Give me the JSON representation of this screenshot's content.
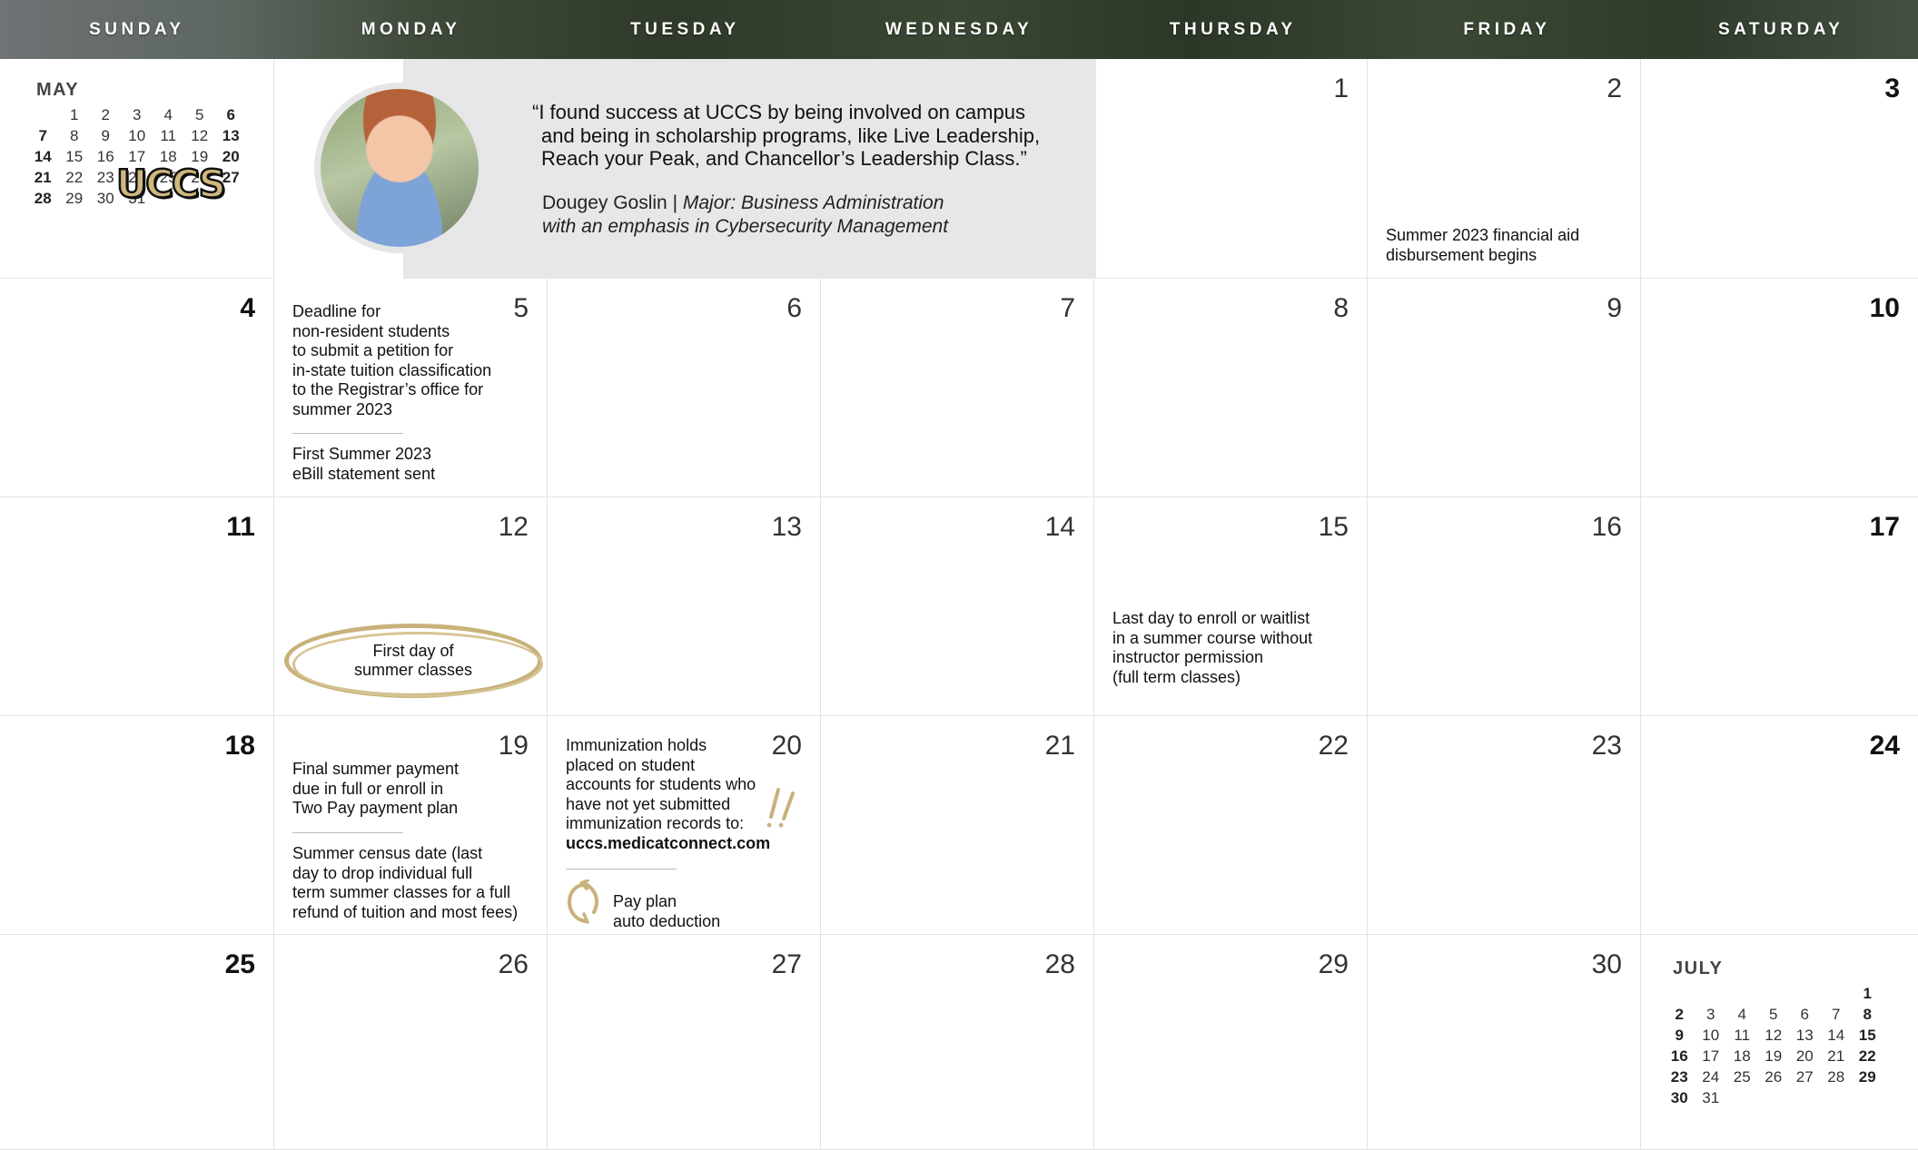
{
  "weekdays": [
    "SUNDAY",
    "MONDAY",
    "TUESDAY",
    "WEDNESDAY",
    "THURSDAY",
    "FRIDAY",
    "SATURDAY"
  ],
  "may_mini": {
    "title": "MAY",
    "rows": [
      [
        "",
        "1",
        "2",
        "3",
        "4",
        "5",
        "6"
      ],
      [
        "7",
        "8",
        "9",
        "10",
        "11",
        "12",
        "13"
      ],
      [
        "14",
        "15",
        "16",
        "17",
        "18",
        "19",
        "20"
      ],
      [
        "21",
        "22",
        "23",
        "24",
        "25",
        "26",
        "27"
      ],
      [
        "28",
        "29",
        "30",
        "31",
        "",
        "",
        ""
      ]
    ]
  },
  "july_mini": {
    "title": "JULY",
    "rows": [
      [
        "",
        "",
        "",
        "",
        "",
        "",
        "1"
      ],
      [
        "2",
        "3",
        "4",
        "5",
        "6",
        "7",
        "8"
      ],
      [
        "9",
        "10",
        "11",
        "12",
        "13",
        "14",
        "15"
      ],
      [
        "16",
        "17",
        "18",
        "19",
        "20",
        "21",
        "22"
      ],
      [
        "23",
        "24",
        "25",
        "26",
        "27",
        "28",
        "29"
      ],
      [
        "30",
        "31",
        "",
        "",
        "",
        "",
        ""
      ]
    ]
  },
  "logo_text": "UCCS",
  "banner": {
    "quote_line1": "“I found success at UCCS by being involved on campus",
    "quote_line2": "and being in scholarship programs, like Live Leadership,",
    "quote_line3": "Reach your Peak, and Chancellor’s Leadership Class.”",
    "name": "Dougey Goslin",
    "separator": " | ",
    "major_line1": "Major: Business Administration",
    "major_line2": "with an emphasis in Cybersecurity Management"
  },
  "days": {
    "d1": "1",
    "d2": "2",
    "d3": "3",
    "d4": "4",
    "d5": "5",
    "d6": "6",
    "d7": "7",
    "d8": "8",
    "d9": "9",
    "d10": "10",
    "d11": "11",
    "d12": "12",
    "d13": "13",
    "d14": "14",
    "d15": "15",
    "d16": "16",
    "d17": "17",
    "d18": "18",
    "d19": "19",
    "d20": "20",
    "d21": "21",
    "d22": "22",
    "d23": "23",
    "d24": "24",
    "d25": "25",
    "d26": "26",
    "d27": "27",
    "d28": "28",
    "d29": "29",
    "d30": "30"
  },
  "events": {
    "june2": [
      "Summer 2023 financial aid",
      "disbursement begins"
    ],
    "june5_a": [
      "Deadline for",
      "non-resident students",
      "to submit a petition for",
      "in-state tuition classification",
      "to the Registrar’s office for",
      "summer 2023"
    ],
    "june5_b": [
      "First Summer 2023",
      "eBill statement sent"
    ],
    "june12": [
      "First day of",
      "summer classes"
    ],
    "june15": [
      "Last day to enroll or waitlist",
      "in a summer course without",
      "instructor permission",
      "(full term classes)"
    ],
    "june19_a": [
      "Final summer payment",
      "due in full or enroll in",
      "Two Pay payment plan"
    ],
    "june19_b": [
      "Summer census date (last",
      "day to drop individual full",
      "term summer classes for a full",
      "refund of tuition and most fees)"
    ],
    "june20_a": [
      "Immunization holds",
      "placed on student",
      "accounts for students who",
      "have not yet submitted",
      "immunization records to:"
    ],
    "june20_url": "uccs.medicatconnect.com",
    "june20_b": [
      "Pay plan",
      "auto deduction"
    ]
  },
  "colors": {
    "gold": "#cfb87c",
    "banner_gray": "#e6e7e8"
  }
}
